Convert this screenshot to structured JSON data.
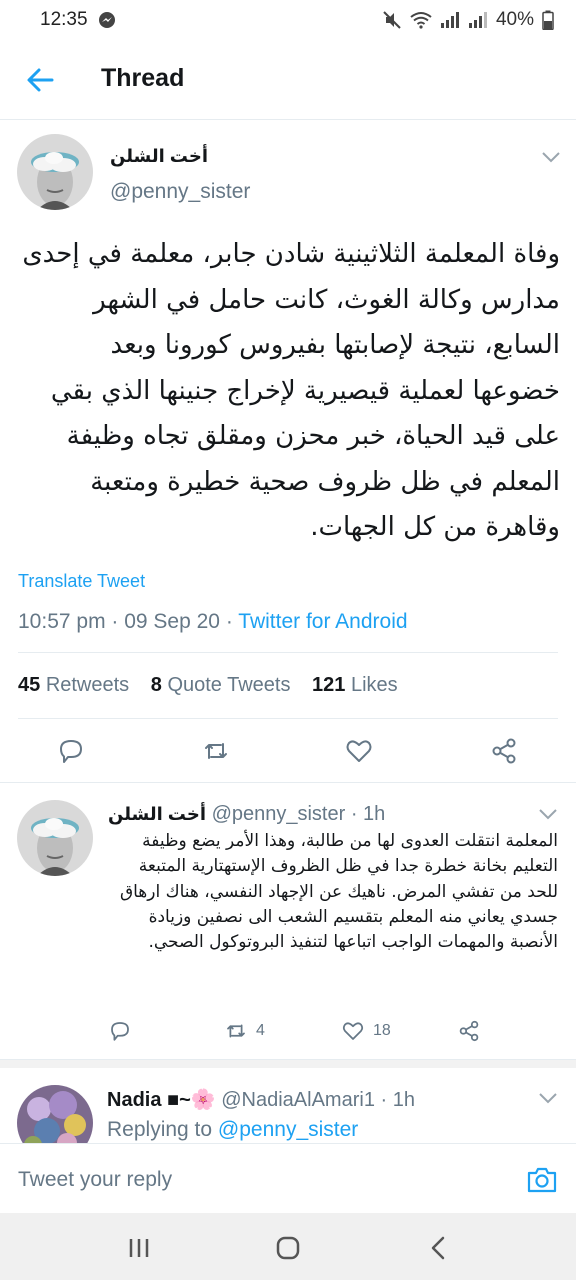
{
  "status_bar": {
    "time": "12:35",
    "battery": "40%",
    "icons": [
      "messenger-icon",
      "mute-icon",
      "wifi-icon",
      "signal-icon",
      "signal-icon",
      "battery-icon"
    ]
  },
  "header": {
    "title": "Thread",
    "back_icon": "back-arrow-icon"
  },
  "main_tweet": {
    "author_name": "أخت الشلن",
    "handle": "@penny_sister",
    "text": "وفاة المعلمة الثلاثينية شادن جابر، معلمة في إحدى مدارس وكالة الغوث، كانت حامل في الشهر السابع، نتيجة لإصابتها بفيروس كورونا وبعد خضوعها لعملية قيصيرية لإخراج جنينها الذي بقي على قيد الحياة، خبر محزن ومقلق تجاه وظيفة المعلم في ظل ظروف صحية خطيرة ومتعبة وقاهرة من كل الجهات.",
    "translate_label": "Translate Tweet",
    "time": "10:57 pm",
    "date": "09 Sep 20",
    "source": "Twitter for Android",
    "retweets_count": "45",
    "retweets_label": "Retweets",
    "quote_count": "8",
    "quote_label": "Quote Tweets",
    "likes_count": "121",
    "likes_label": "Likes"
  },
  "reply_tweet": {
    "author_name": "أخت الشلن",
    "handle": "@penny_sister",
    "age": "1h",
    "text": "المعلمة انتقلت العدوى لها من طالبة، وهذا الأمر يضع وظيفة التعليم  بخانة خطرة جدا في ظل الظروف الإستهتارية المتبعة للحد من تفشي المرض. ناهيك عن الإجهاد النفسي، هناك ارهاق جسدي يعاني منه المعلم بتقسيم الشعب الى نصفين وزيادة الأنصبة والمهمات الواجب اتباعها لتنفيذ البروتوكول الصحي.",
    "retweets": "4",
    "likes": "18"
  },
  "third_tweet": {
    "author_name": "Nadia ■~🌸",
    "handle": "@NadiaAlAmari1",
    "age": "1h",
    "replying_label": "Replying to",
    "replying_to": "@penny_sister"
  },
  "compose": {
    "placeholder": "Tweet your reply"
  },
  "colors": {
    "accent": "#1da1f2",
    "text": "#14171a",
    "muted": "#657786",
    "border": "#e6ecf0"
  }
}
